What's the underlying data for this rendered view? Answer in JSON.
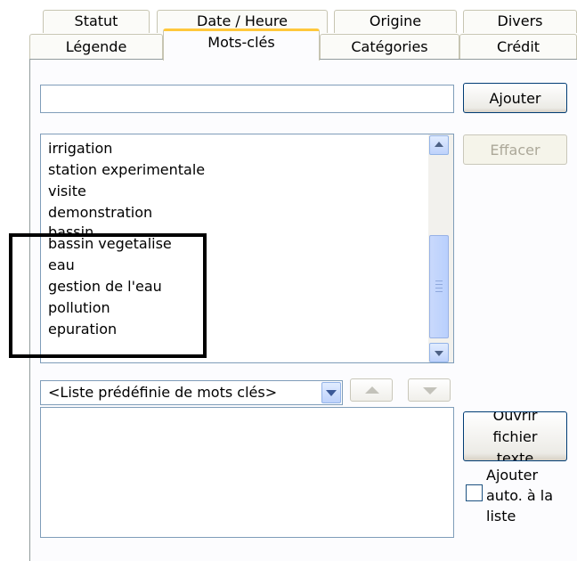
{
  "tabs_back": [
    "Statut",
    "Date / Heure",
    "Origine",
    "Divers"
  ],
  "tabs_front": [
    "Légende",
    "Mots-clés",
    "Catégories",
    "Crédit"
  ],
  "active_tab": "Mots-clés",
  "keyword_input": {
    "value": "",
    "placeholder": ""
  },
  "buttons": {
    "add": "Ajouter",
    "delete": "Effacer",
    "open_file": "Ouvrir fichier texte"
  },
  "keywords": [
    "irrigation",
    "station experimentale",
    "visite",
    "demonstration",
    "bassin",
    "bassin vegetalise",
    "eau",
    "gestion de l'eau",
    "pollution",
    "epuration"
  ],
  "predefined_combo": {
    "selected": "<Liste prédéfinie de mots clés>"
  },
  "auto_add_checkbox": {
    "label": "Ajouter auto. à la liste",
    "checked": false
  },
  "colors": {
    "accent_tab": "#ffc83c",
    "scrollbar": "#c1d3fb",
    "field_border": "#7f9db9",
    "highlight_box": "#000000"
  },
  "icons": {
    "scroll_up": "chevron-up-icon",
    "scroll_down": "chevron-down-icon",
    "combo_arrow": "chevron-down-icon",
    "move_up": "triangle-up-icon",
    "move_down": "triangle-down-icon"
  }
}
